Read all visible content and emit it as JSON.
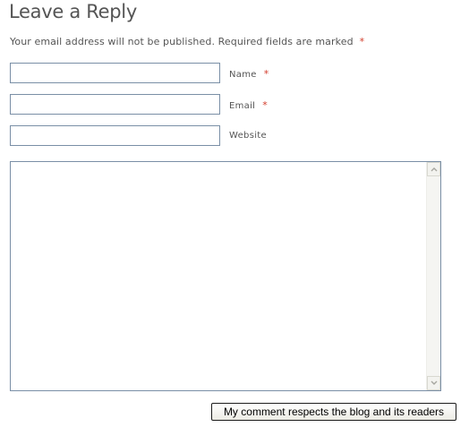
{
  "form": {
    "title": "Leave a Reply",
    "notes": "Your email address will not be published. Required fields are marked",
    "required_mark": "*",
    "fields": [
      {
        "label": "Name",
        "value": "",
        "required": true
      },
      {
        "label": "Email",
        "value": "",
        "required": true
      },
      {
        "label": "Website",
        "value": "",
        "required": false
      }
    ],
    "comment": {
      "value": ""
    },
    "submit_label": "My comment respects the blog and its readers"
  },
  "colors": {
    "required": "#d23b2a",
    "input_border": "#7a8fa6",
    "text": "#555555"
  },
  "icons": {
    "scroll_up": "chevron-up-icon",
    "scroll_down": "chevron-down-icon"
  }
}
